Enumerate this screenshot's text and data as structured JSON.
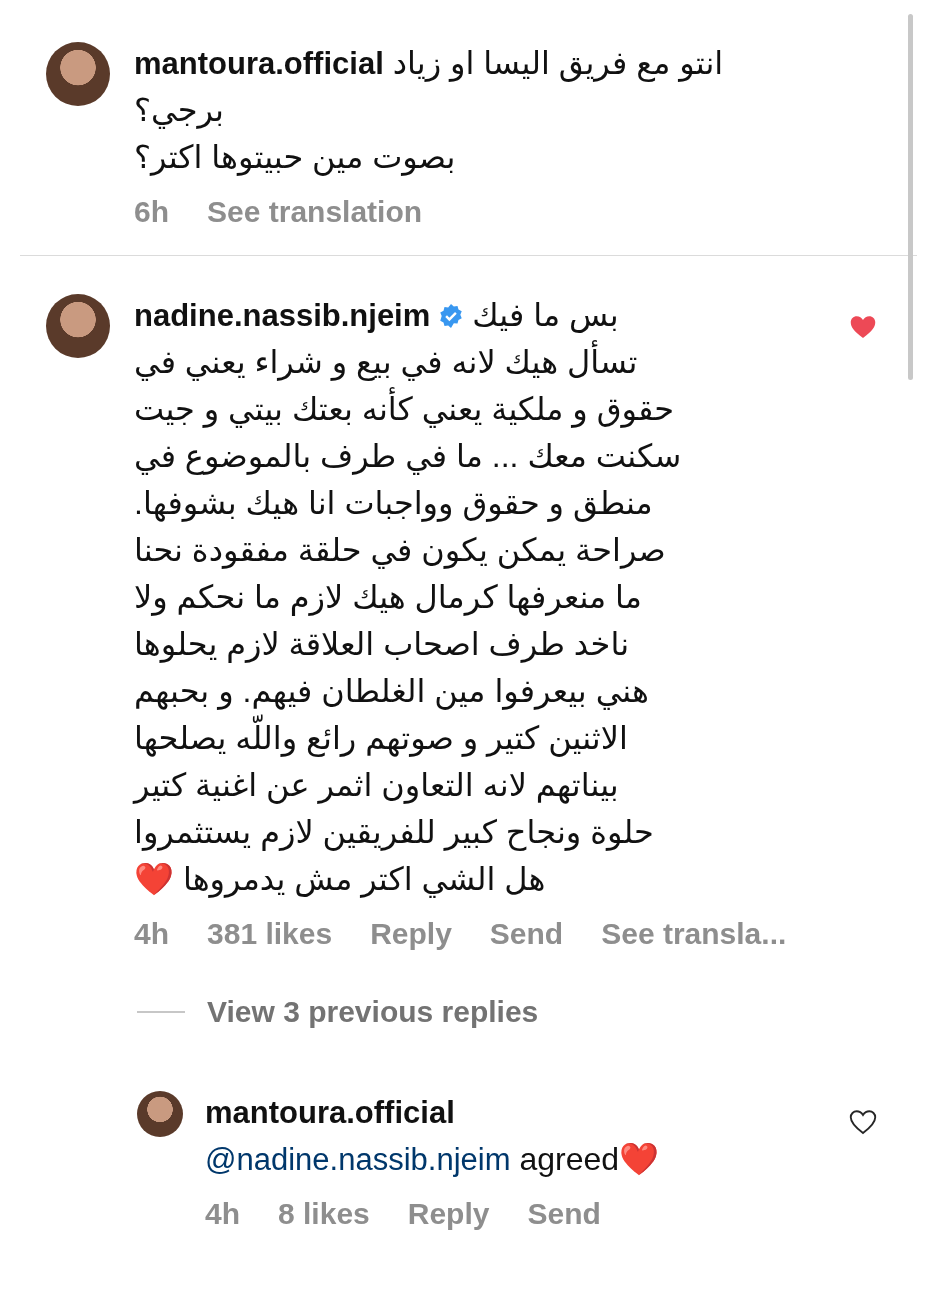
{
  "comments": [
    {
      "username": "mantoura.official",
      "lines": [
        "انتو مع فريق اليسا او زياد",
        "برجي؟",
        "بصوت مين حبيتوها اكتر؟"
      ],
      "time": "6h",
      "translate": "See translation"
    },
    {
      "username": "nadine.nassib.njeim",
      "verified": true,
      "liked": true,
      "lines": [
        "بس ما فيك",
        "تسأل هيك لانه في بيع و شراء يعني في",
        "حقوق و ملكية يعني كأنه بعتك بيتي و جيت",
        "سكنت معك ... ما في طرف بالموضوع في",
        "منطق و حقوق وواجبات انا هيك بشوفها.",
        "صراحة يمكن يكون في حلقة مفقودة نحنا",
        "ما منعرفها كرمال هيك لازم ما نحكم ولا",
        "ناخد طرف اصحاب العلاقة لازم يحلوها",
        "هني بيعرفوا مين الغلطان فيهم. و بحبهم",
        "الاثنين كتير و صوتهم رائع واللّه يصلحها",
        "بيناتهم لانه التعاون اثمر عن اغنية كتير",
        "حلوة ونجاح كبير للفريقين لازم يستثمروا",
        "هل الشي اكتر مش يدمروها ❤️"
      ],
      "time": "4h",
      "likes": "381 likes",
      "reply": "Reply",
      "send": "Send",
      "translate": "See transla...",
      "view_replies": "View 3 previous replies",
      "replies": [
        {
          "username": "mantoura.official",
          "liked": false,
          "mention": "@nadine.nassib.njeim",
          "text": "agreed❤️",
          "time": "4h",
          "likes": "8 likes",
          "reply": "Reply",
          "send": "Send"
        }
      ]
    }
  ]
}
